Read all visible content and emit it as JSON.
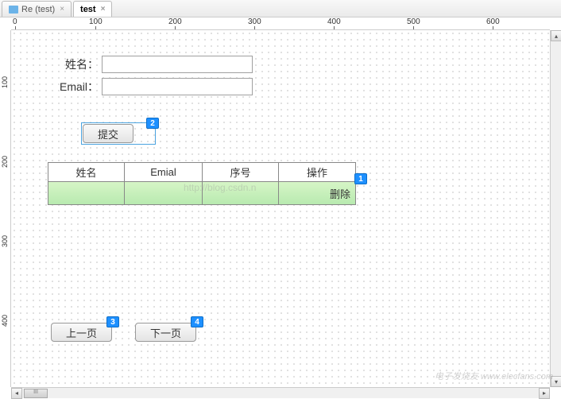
{
  "tabs": {
    "items": [
      {
        "label": "Re (test)",
        "active": false,
        "hasIcon": true
      },
      {
        "label": "test",
        "active": true,
        "hasIcon": false
      }
    ]
  },
  "ruler": {
    "h": [
      "0",
      "100",
      "200",
      "300",
      "400",
      "500",
      "600"
    ],
    "v": [
      "100",
      "200",
      "300",
      "400"
    ]
  },
  "form": {
    "name_label": "姓名：",
    "email_label": "Email：",
    "name_value": "",
    "email_value": ""
  },
  "buttons": {
    "submit": "提交",
    "prev": "上一页",
    "next": "下一页"
  },
  "badges": {
    "b1": "1",
    "b2": "2",
    "b3": "3",
    "b4": "4"
  },
  "table": {
    "headers": [
      "姓名",
      "Emial",
      "序号",
      "操作"
    ],
    "row": {
      "col1": "",
      "col2": "",
      "col3": "",
      "action": "删除"
    },
    "watermark": "http://blog.csdn.n"
  },
  "scrollbar": {
    "thumb_label": "III"
  },
  "watermark_logo": "电子发烧友  www.elecfans.com"
}
